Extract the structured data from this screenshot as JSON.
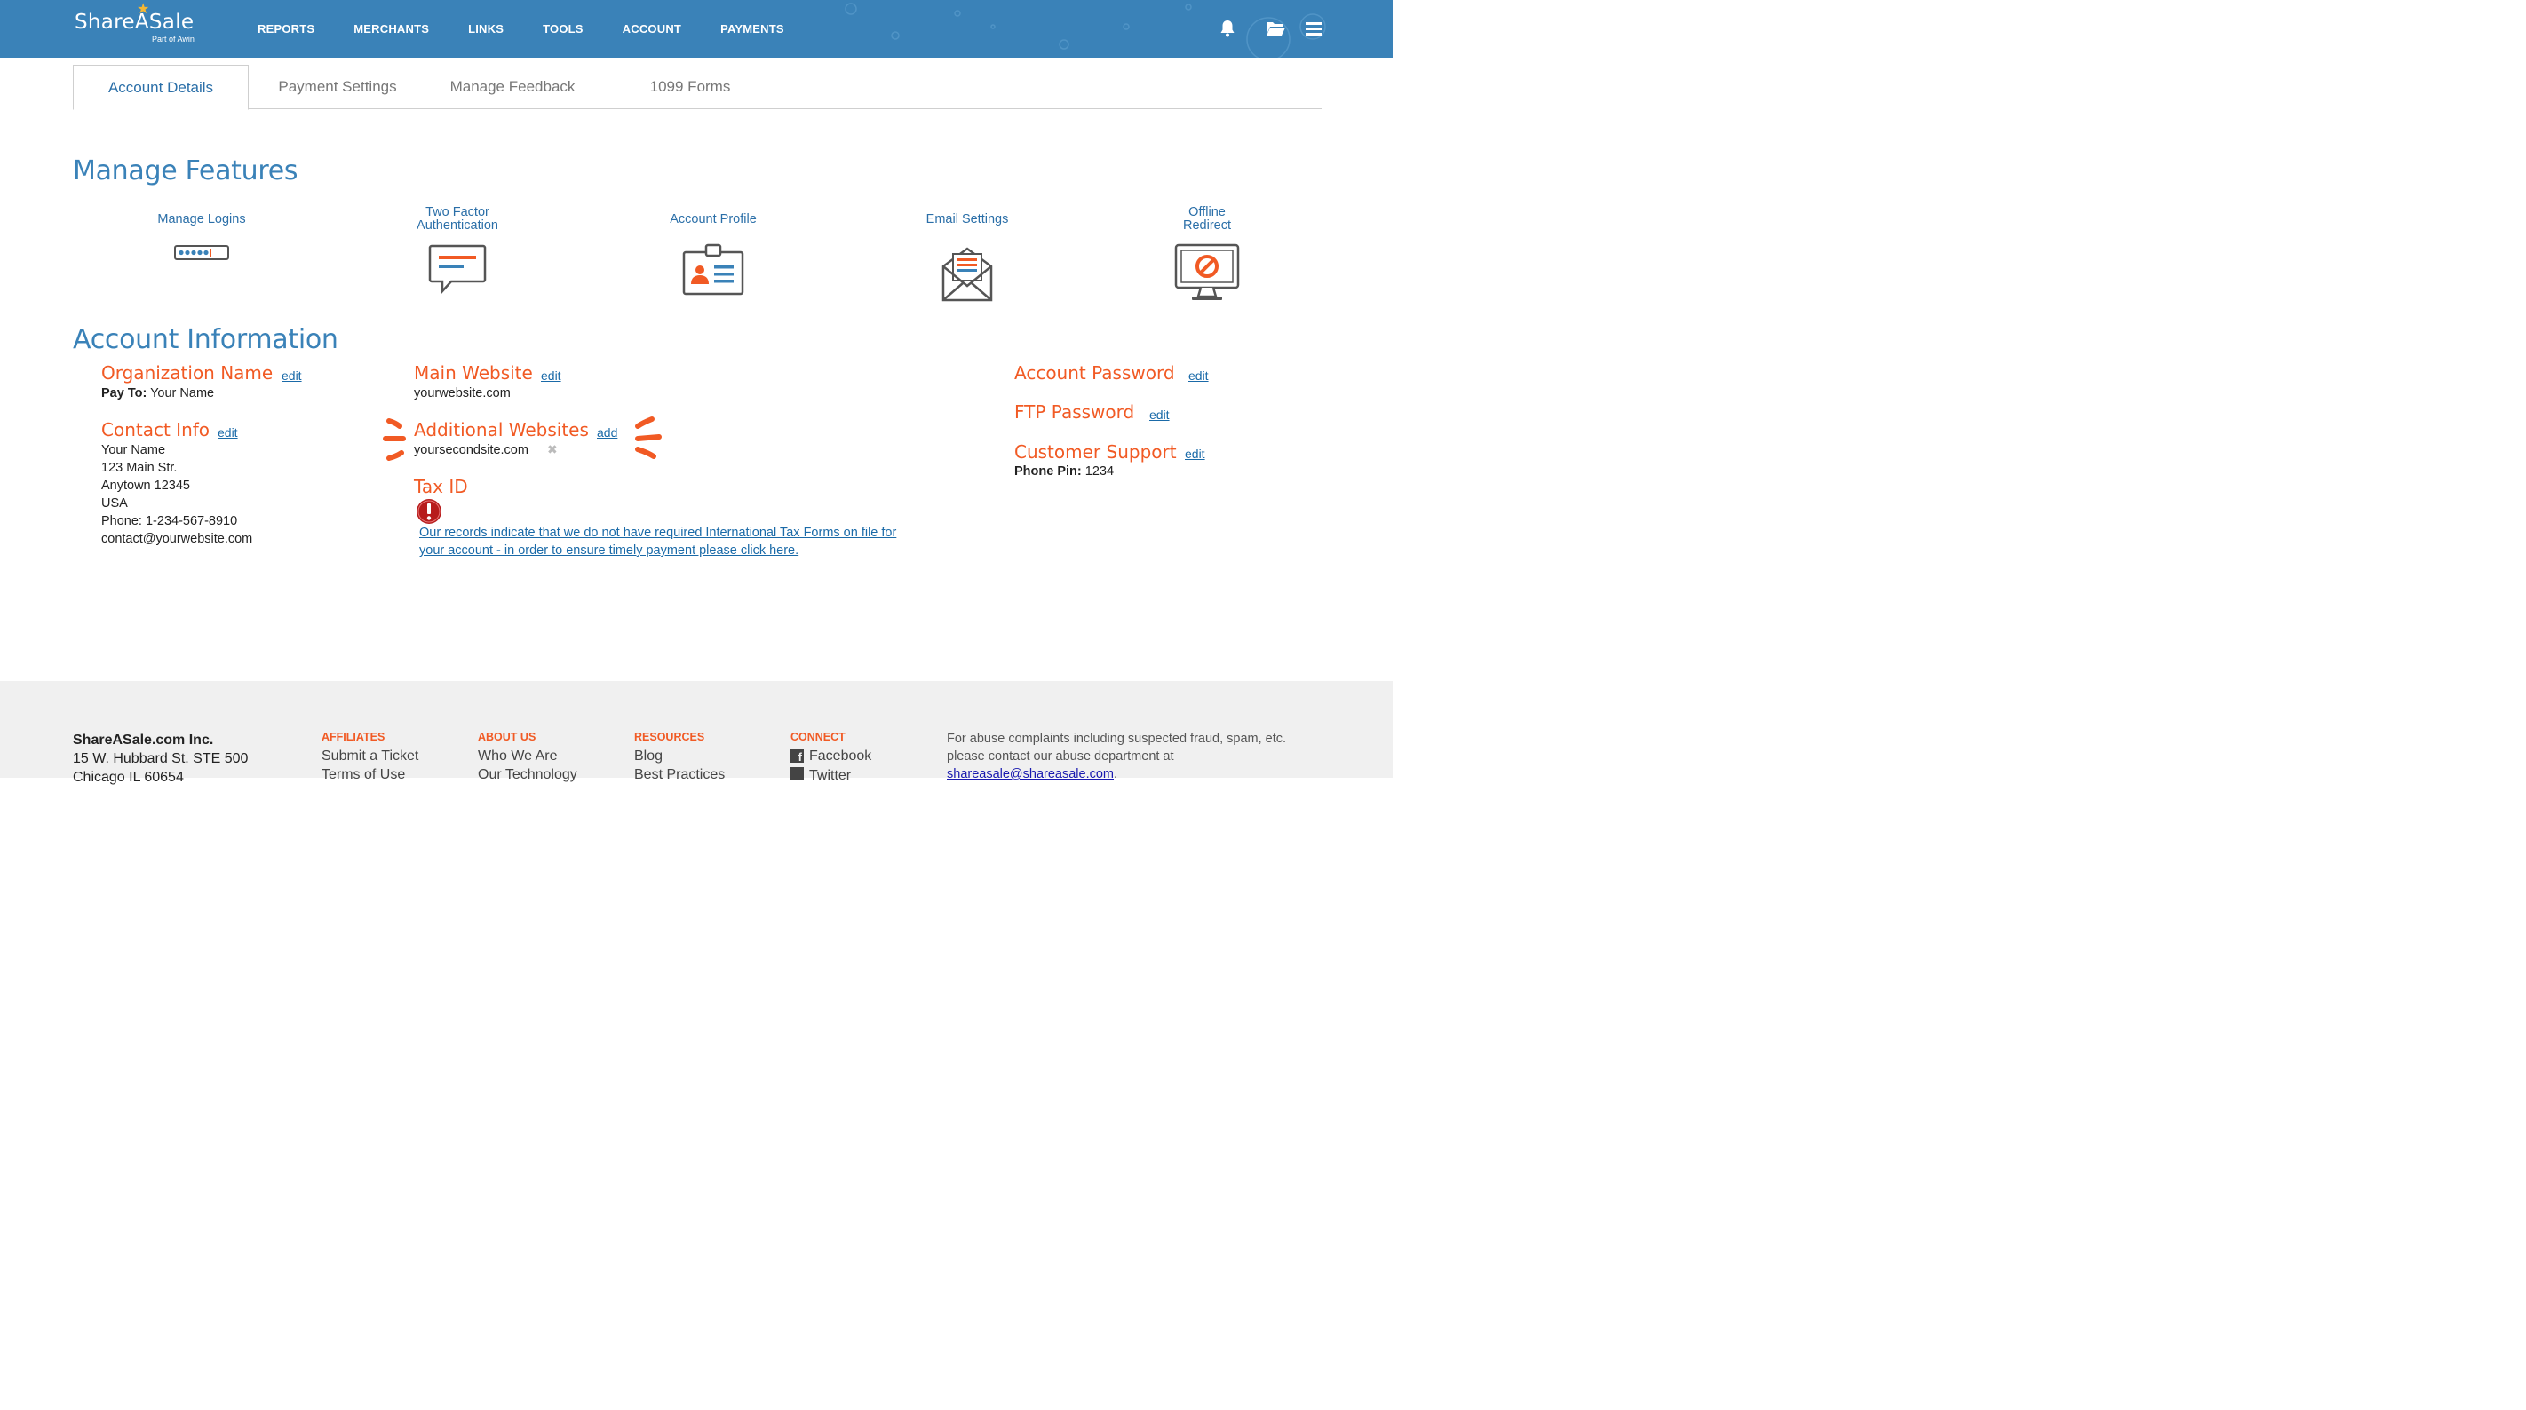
{
  "header": {
    "logo_text": "ShareASale",
    "logo_sub": "Part of Awin",
    "nav": [
      "REPORTS",
      "MERCHANTS",
      "LINKS",
      "TOOLS",
      "ACCOUNT",
      "PAYMENTS"
    ],
    "icons": [
      "bell-icon",
      "folder-icon",
      "menu-icon"
    ]
  },
  "tabs": [
    "Account Details",
    "Payment Settings",
    "Manage Feedback",
    "1099 Forms"
  ],
  "manage_features": {
    "title": "Manage Features",
    "items": [
      {
        "label": "Manage Logins",
        "icon": "password-field-icon"
      },
      {
        "label_line1": "Two Factor",
        "label_line2": "Authentication",
        "icon": "chat-bubble-icon"
      },
      {
        "label": "Account Profile",
        "icon": "id-badge-icon"
      },
      {
        "label": "Email Settings",
        "icon": "envelope-icon"
      },
      {
        "label_line1": "Offline",
        "label_line2": "Redirect",
        "icon": "monitor-block-icon"
      }
    ]
  },
  "account_info": {
    "title": "Account Information",
    "org_name": {
      "label": "Organization Name",
      "action": "edit",
      "payto_label": "Pay To:",
      "payto_value": "Your Name"
    },
    "contact": {
      "label": "Contact Info",
      "action": "edit",
      "lines": [
        "Your Name",
        "123 Main Str.",
        "Anytown 12345",
        "USA",
        "Phone: 1-234-567-8910",
        "contact@yourwebsite.com"
      ]
    },
    "main_website": {
      "label": "Main Website",
      "action": "edit",
      "value": "yourwebsite.com"
    },
    "additional_websites": {
      "label": "Additional Websites",
      "action": "add",
      "value": "yoursecondsite.com"
    },
    "tax_id": {
      "label": "Tax ID",
      "notice": "Our records indicate that we do not have required International Tax Forms on file for your account - in order to ensure timely payment please click here."
    },
    "account_password": {
      "label": "Account Password",
      "action": "edit"
    },
    "ftp_password": {
      "label": "FTP Password",
      "action": "edit"
    },
    "customer_support": {
      "label": "Customer Support",
      "action": "edit",
      "pin_label": "Phone Pin:",
      "pin_value": "1234"
    }
  },
  "footer": {
    "company": [
      "ShareASale.com Inc.",
      "15 W. Hubbard St. STE 500",
      "Chicago IL 60654"
    ],
    "columns": [
      {
        "head": "AFFILIATES",
        "items": [
          "Submit a Ticket",
          "Terms of Use"
        ]
      },
      {
        "head": "ABOUT US",
        "items": [
          "Who We Are",
          "Our Technology"
        ]
      },
      {
        "head": "RESOURCES",
        "items": [
          "Blog",
          "Best Practices"
        ]
      },
      {
        "head": "CONNECT",
        "items": [
          "Facebook",
          "Twitter"
        ]
      }
    ],
    "abuse_text": "For abuse complaints including suspected fraud, spam, etc. please contact our abuse department at",
    "abuse_email": "shareasale@shareasale.com"
  },
  "colors": {
    "brand_blue": "#3a82b8",
    "accent_orange": "#f15a24",
    "link_blue": "#1a6aa8",
    "alert_red": "#b71c1c"
  }
}
